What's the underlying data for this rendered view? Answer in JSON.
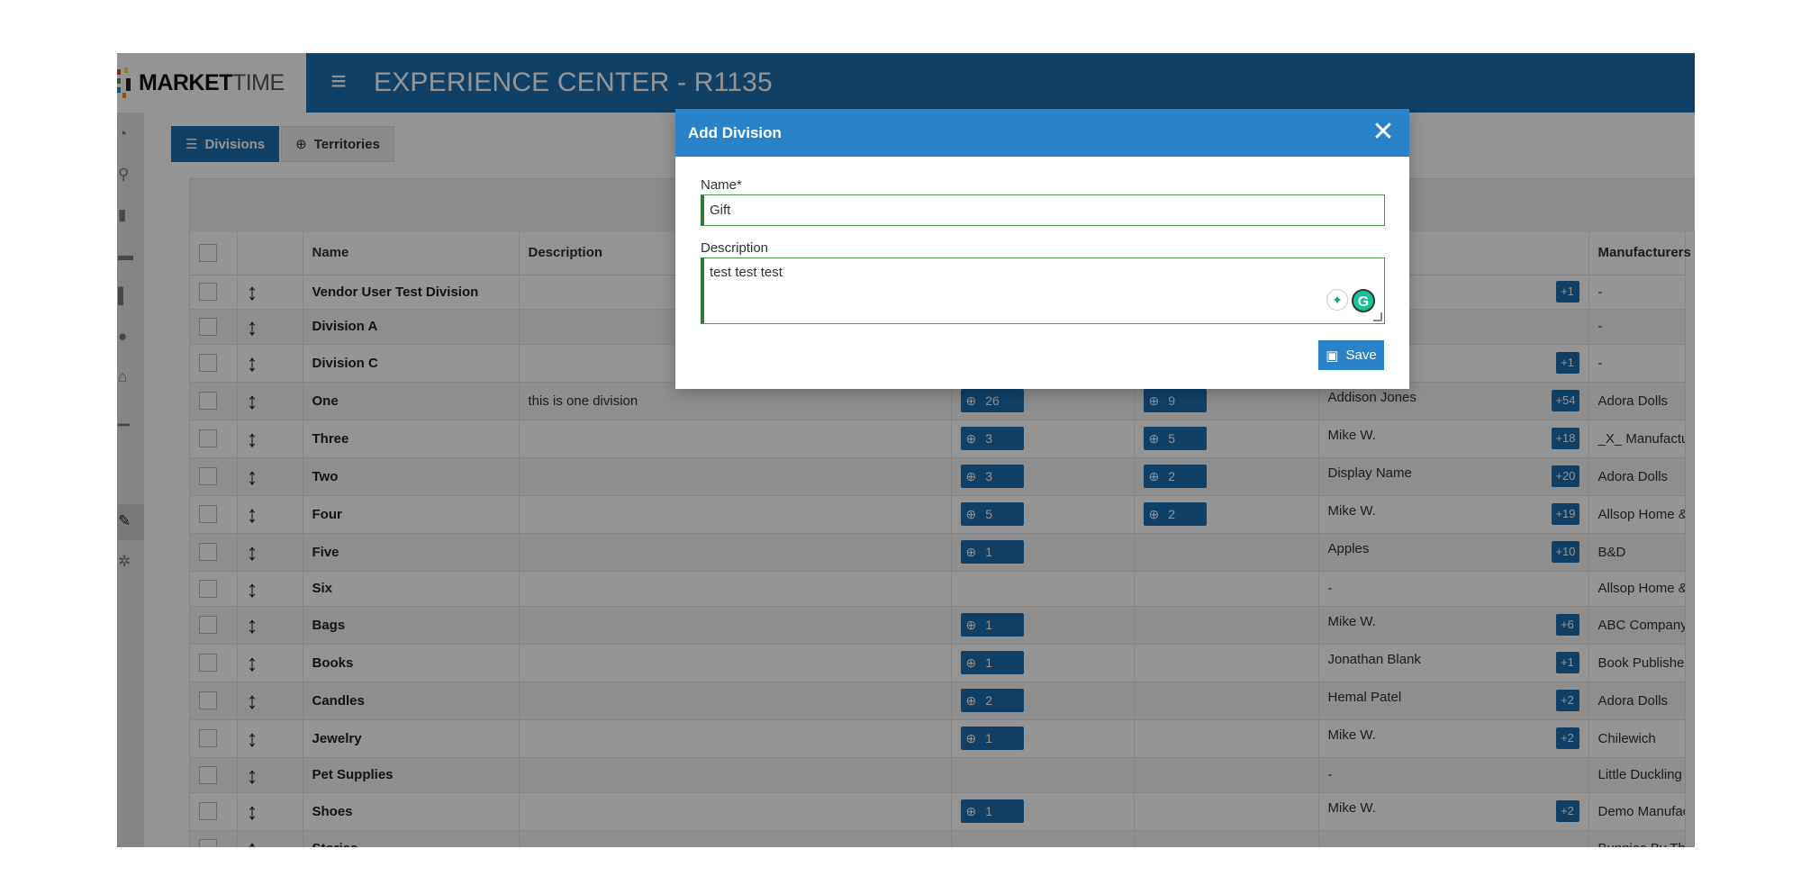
{
  "header": {
    "logo_primary": "MARKET",
    "logo_secondary": "TIME",
    "app_title": "EXPERIENCE CENTER - R1135",
    "menu_icon": "hamburger-icon"
  },
  "sidebar": {
    "icons": [
      "dashboard-icon",
      "search-icon",
      "document-icon",
      "id-card-icon",
      "building-icon",
      "users-icon",
      "bank-icon",
      "chart-icon",
      "wrench-icon",
      "network-icon"
    ],
    "active": "wrench-icon"
  },
  "tabs": [
    {
      "label": "Divisions",
      "icon": "sliders-icon",
      "active": true
    },
    {
      "label": "Territories",
      "icon": "globe-icon",
      "active": false
    }
  ],
  "table": {
    "headers": [
      "",
      "",
      "Name",
      "Description",
      "",
      "",
      "",
      "Manufacturers"
    ],
    "rows": [
      {
        "name": "Vendor User Test Division",
        "description": "",
        "territories": "",
        "regions": "",
        "owner": "",
        "owner_extra": "+1",
        "manufacturer": "-"
      },
      {
        "name": "Division A",
        "description": "",
        "territories": "",
        "regions": "",
        "owner": "",
        "owner_extra": "",
        "manufacturer": "-"
      },
      {
        "name": "Division C",
        "description": "",
        "territories": "",
        "regions": "",
        "owner": "",
        "owner_extra": "+1",
        "manufacturer": "-"
      },
      {
        "name": "One",
        "description": "this is one division",
        "territories": "26",
        "regions": "9",
        "owner": "Addison Jones",
        "owner_extra": "+54",
        "manufacturer": "Adora Dolls"
      },
      {
        "name": "Three",
        "description": "",
        "territories": "3",
        "regions": "5",
        "owner": "Mike W.",
        "owner_extra": "+18",
        "manufacturer": "_X_ Manufacture"
      },
      {
        "name": "Two",
        "description": "",
        "territories": "3",
        "regions": "2",
        "owner": "Display Name",
        "owner_extra": "+20",
        "manufacturer": "Adora Dolls"
      },
      {
        "name": "Four",
        "description": "",
        "territories": "5",
        "regions": "2",
        "owner": "Mike W.",
        "owner_extra": "+19",
        "manufacturer": "Allsop Home & G"
      },
      {
        "name": "Five",
        "description": "",
        "territories": "1",
        "regions": "",
        "owner": "Apples",
        "owner_extra": "+10",
        "manufacturer": "B&D"
      },
      {
        "name": "Six",
        "description": "",
        "territories": "",
        "regions": "",
        "owner": "-",
        "owner_extra": "",
        "manufacturer": "Allsop Home & G"
      },
      {
        "name": "Bags",
        "description": "",
        "territories": "1",
        "regions": "",
        "owner": "Mike W.",
        "owner_extra": "+6",
        "manufacturer": "ABC Company"
      },
      {
        "name": "Books",
        "description": "",
        "territories": "1",
        "regions": "",
        "owner": "Jonathan Blank",
        "owner_extra": "+1",
        "manufacturer": "Book Publishers"
      },
      {
        "name": "Candles",
        "description": "",
        "territories": "2",
        "regions": "",
        "owner": "Hemal Patel",
        "owner_extra": "+2",
        "manufacturer": "Adora Dolls"
      },
      {
        "name": "Jewelry",
        "description": "",
        "territories": "1",
        "regions": "",
        "owner": "Mike W.",
        "owner_extra": "+2",
        "manufacturer": "Chilewich"
      },
      {
        "name": "Pet Supplies",
        "description": "",
        "territories": "",
        "regions": "",
        "owner": "-",
        "owner_extra": "",
        "manufacturer": "Little Duckling"
      },
      {
        "name": "Shoes",
        "description": "",
        "territories": "1",
        "regions": "",
        "owner": "Mike W.",
        "owner_extra": "+2",
        "manufacturer": "Demo Manufact"
      },
      {
        "name": "Stories",
        "description": "",
        "territories": "",
        "regions": "",
        "owner": "-",
        "owner_extra": "",
        "manufacturer": "Bunnies By The"
      }
    ]
  },
  "modal": {
    "title": "Add Division",
    "name_label": "Name*",
    "name_value": "Gift",
    "description_label": "Description",
    "description_value": "test test test",
    "save_label": "Save"
  },
  "colors": {
    "header_blue": "#1e6fb0",
    "modal_header_blue": "#2a83c9",
    "field_valid_green": "#2f7a32"
  }
}
